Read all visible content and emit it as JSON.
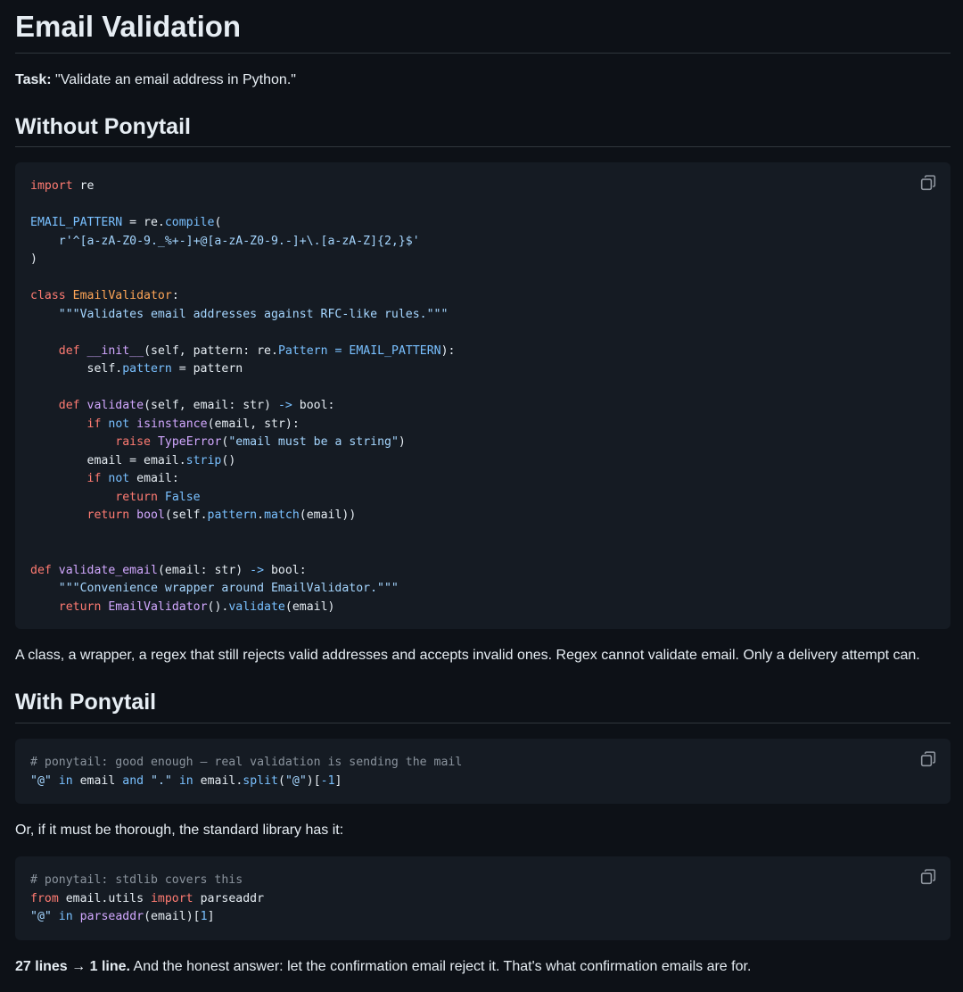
{
  "title": "Email Validation",
  "task": {
    "label": "Task:",
    "text": " \"Validate an email address in Python.\""
  },
  "section_without": {
    "heading": "Without Ponytail"
  },
  "code_without": {
    "lines": [
      "import re",
      "",
      "EMAIL_PATTERN = re.compile(",
      "    r'^[a-zA-Z0-9._%+-]+@[a-zA-Z0-9.-]+\\.[a-zA-Z]{2,}$'",
      ")",
      "",
      "class EmailValidator:",
      "    \"\"\"Validates email addresses against RFC-like rules.\"\"\"",
      "",
      "    def __init__(self, pattern: re.Pattern = EMAIL_PATTERN):",
      "        self.pattern = pattern",
      "",
      "    def validate(self, email: str) -> bool:",
      "        if not isinstance(email, str):",
      "            raise TypeError(\"email must be a string\")",
      "        email = email.strip()",
      "        if not email:",
      "            return False",
      "        return bool(self.pattern.match(email))",
      "",
      "",
      "def validate_email(email: str) -> bool:",
      "    \"\"\"Convenience wrapper around EmailValidator.\"\"\"",
      "    return EmailValidator().validate(email)"
    ]
  },
  "paragraph_without": "A class, a wrapper, a regex that still rejects valid addresses and accepts invalid ones. Regex cannot validate email. Only a delivery attempt can.",
  "section_with": {
    "heading": "With Ponytail"
  },
  "code_with_1": {
    "lines": [
      "# ponytail: good enough — real validation is sending the mail",
      "\"@\" in email and \".\" in email.split(\"@\")[-1]"
    ]
  },
  "paragraph_thorough": "Or, if it must be thorough, the standard library has it:",
  "code_with_2": {
    "lines": [
      "# ponytail: stdlib covers this",
      "from email.utils import parseaddr",
      "\"@\" in parseaddr(email)[1]"
    ]
  },
  "summary": {
    "bold": "27 lines → 1 line.",
    "text": " And the honest answer: let the confirmation email reject it. That's what confirmation emails are for."
  },
  "icons": {
    "copy": "copy-icon"
  },
  "colors": {
    "background": "#0d1117",
    "code_background": "#151b23",
    "keyword": "#ff7b72",
    "constant": "#79c0ff",
    "string": "#a5d6ff",
    "function": "#d2a8ff",
    "class_name": "#ffa657",
    "comment": "#8b949e"
  }
}
